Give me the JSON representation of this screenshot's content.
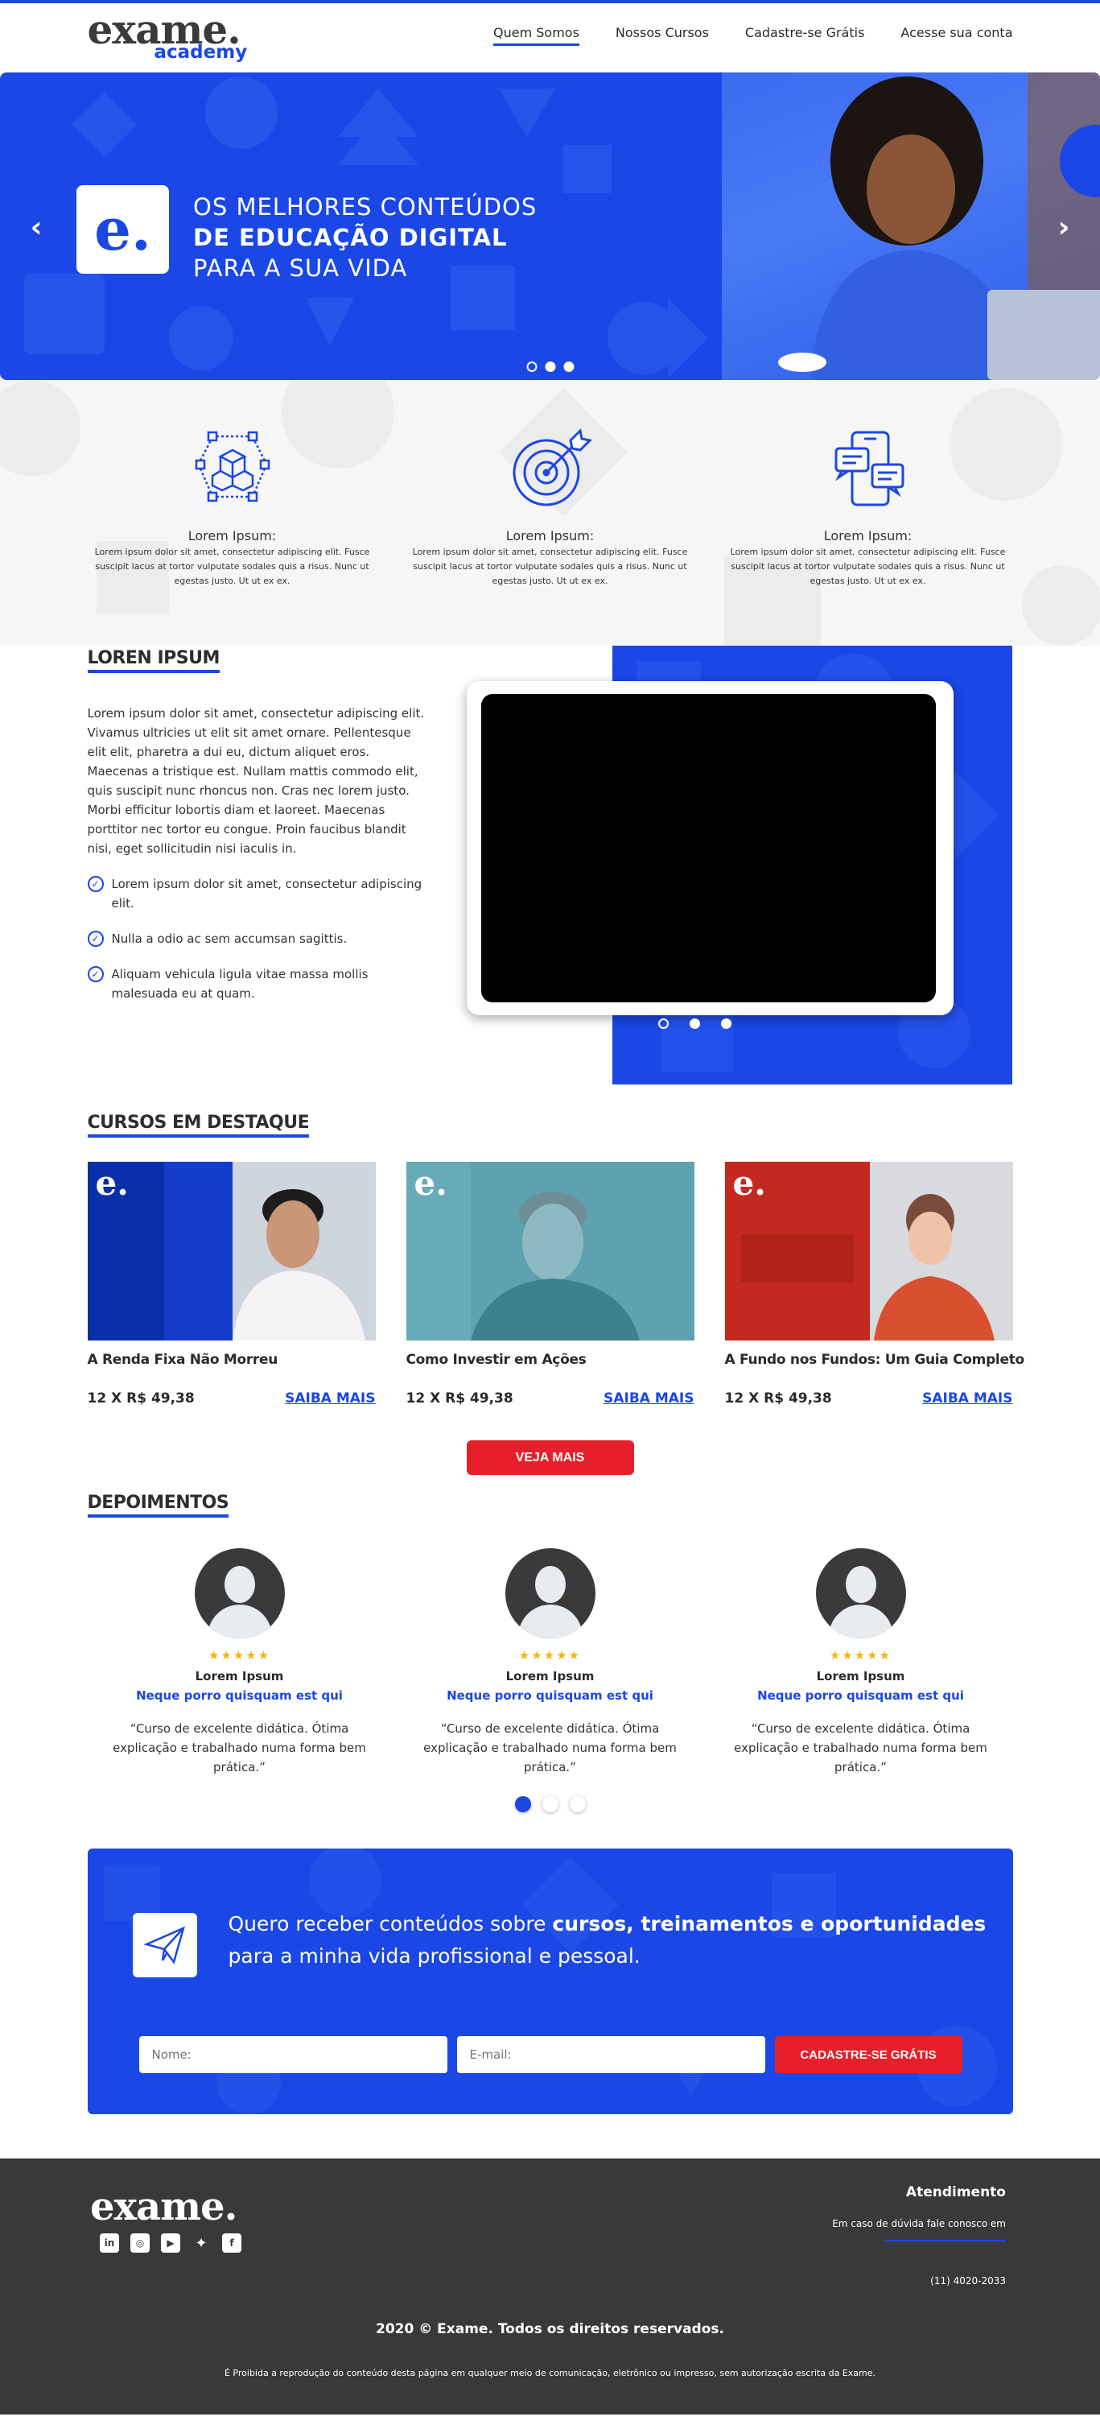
{
  "brand": {
    "logo_main": "exame.",
    "logo_sub": "academy",
    "accent_color": "#1a47e5",
    "cta_color": "#e61f2a",
    "dark_color": "#39393b"
  },
  "nav": {
    "items": [
      {
        "label": "Quem Somos",
        "active": true
      },
      {
        "label": "Nossos Cursos",
        "active": false
      },
      {
        "label": "Cadastre-se Grátis",
        "active": false
      },
      {
        "label": "Acesse sua conta",
        "active": false
      }
    ]
  },
  "hero": {
    "badge_letter": "e.",
    "line1": "OS MELHORES CONTEÚDOS",
    "line2": "DE EDUCAÇÃO DIGITAL",
    "line3": "PARA A SUA VIDA",
    "prev_icon": "chevron-left-icon",
    "next_icon": "chevron-right-icon",
    "slide_count": 3,
    "active_slide": 2
  },
  "features": [
    {
      "icon": "boxes-network-icon",
      "title": "Lorem Ipsum:",
      "text": "Lorem ipsum dolor sit amet, consectetur adipiscing elit. Fusce suscipit lacus at tortor vulputate sodales quis a risus. Nunc ut egestas justo. Ut ut ex ex."
    },
    {
      "icon": "target-arrow-icon",
      "title": "Lorem Ipsum:",
      "text": "Lorem ipsum dolor sit amet, consectetur adipiscing elit. Fusce suscipit lacus at tortor vulputate sodales quis a risus. Nunc ut egestas justo. Ut ut ex ex."
    },
    {
      "icon": "phone-chat-icon",
      "title": "Lorem Ipsum:",
      "text": "Lorem ipsum dolor sit amet, consectetur adipiscing elit. Fusce suscipit lacus at tortor vulputate sodales quis a risus. Nunc ut egestas justo. Ut ut ex ex."
    }
  ],
  "about": {
    "title": "LOREN IPSUM",
    "text": "Lorem ipsum dolor sit amet, consectetur adipiscing elit. Vivamus ultricies ut elit sit amet ornare. Pellentesque elit elit, pharetra a dui eu, dictum aliquet eros. Maecenas a tristique est. Nullam mattis commodo elit, quis suscipit nunc rhoncus non. Cras nec lorem justo. Morbi efficitur lobortis diam et laoreet. Maecenas porttitor nec tortor eu congue. Proin faucibus blandit nisi, eget sollicitudin nisi iaculis in.",
    "checks": [
      "Lorem ipsum dolor sit amet, consectetur adipiscing elit.",
      "Nulla a odio ac sem accumsan sagittis.",
      "Aliquam vehicula ligula vitae massa mollis malesuada eu at quam."
    ],
    "check_icon": "check-circle-icon",
    "slide_count": 3,
    "active_slide": 0
  },
  "courses": {
    "title": "CURSOS EM DESTAQUE",
    "items": [
      {
        "title": "A Renda Fixa Não Morreu",
        "price": "12 X R$ 49,38",
        "more": "SAIBA MAIS",
        "badge": "e.",
        "theme": "#0b2fa8"
      },
      {
        "title": "Como Investir em Ações",
        "price": "12 X R$ 49,38",
        "more": "SAIBA MAIS",
        "badge": "e.",
        "theme": "#4f95a3"
      },
      {
        "title": "A Fundo nos Fundos: Um Guia Completo",
        "price": "12 X R$ 49,38",
        "more": "SAIBA MAIS",
        "badge": "e.",
        "theme": "#c4291f"
      }
    ],
    "button": "VEJA MAIS"
  },
  "testimonials": {
    "title": "DEPOIMENTOS",
    "items": [
      {
        "stars": "★★★★★",
        "name": "Lorem Ipsum",
        "role": "Neque porro quisquam est qui",
        "quote": "“Curso de excelente didática. Ótima explicação e trabalhado numa forma bem prática.”"
      },
      {
        "stars": "★★★★★",
        "name": "Lorem Ipsum",
        "role": "Neque porro quisquam est qui",
        "quote": "“Curso de excelente didática. Ótima explicação e trabalhado numa forma bem prática.”"
      },
      {
        "stars": "★★★★★",
        "name": "Lorem Ipsum",
        "role": "Neque porro quisquam est qui",
        "quote": "“Curso de excelente didática. Ótima explicação e trabalhado numa forma bem prática.”"
      }
    ],
    "slide_count": 3,
    "active_slide": 0
  },
  "newsletter": {
    "icon": "paper-plane-icon",
    "text_normal": "Quero receber conteúdos sobre ",
    "text_bold": "cursos, treinamentos e oportunidades",
    "text_line2": "para a minha vida profissional e pessoal.",
    "name_placeholder": "Nome:",
    "email_placeholder": "E-mail:",
    "button": "CADASTRE-SE GRÁTIS"
  },
  "footer": {
    "logo": "exame.",
    "socials": [
      "linkedin-icon",
      "instagram-icon",
      "youtube-icon",
      "twitter-icon",
      "facebook-icon"
    ],
    "service_title": "Atendimento",
    "service_text": "Em caso de dúvida fale conosco em",
    "phone": "(11) 4020-2033",
    "copyright": "2020 © Exame. Todos os direitos reservados.",
    "legal": "É Proibida a reprodução do conteúdo desta página em qualquer meio de comunicação, eletrônico ou impresso, sem autorização escrita da Exame."
  }
}
